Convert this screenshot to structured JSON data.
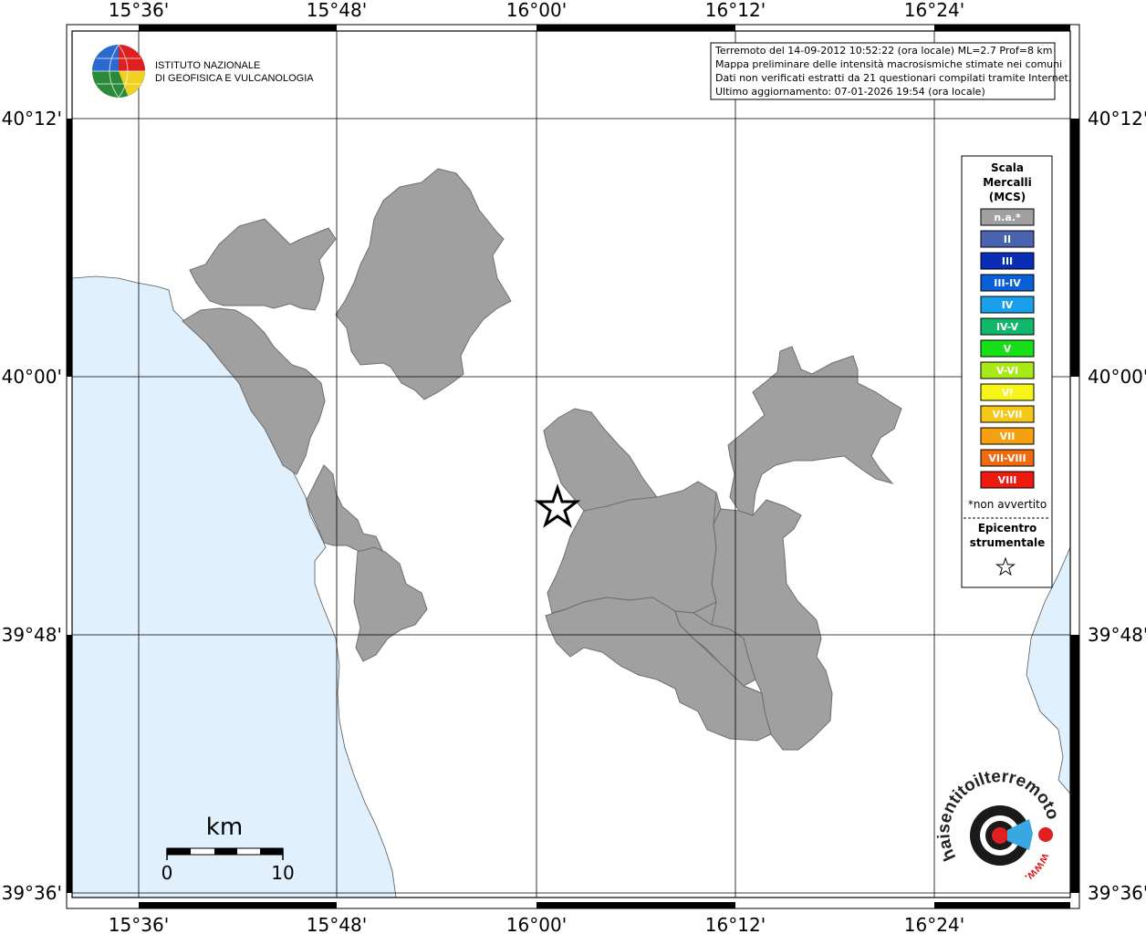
{
  "institute": {
    "line1": "ISTITUTO NAZIONALE",
    "line2": "DI GEOFISICA E VULCANOLOGIA"
  },
  "info": {
    "line1": "Terremoto del 14-09-2012 10:52:22 (ora locale) ML=2.7 Prof=8 km",
    "line2": "Mappa preliminare delle intensità macrosismiche stimate nei comuni",
    "line3": "Dati non verificati estratti da 21 questionari compilati tramite Internet.",
    "line4": "Ultimo aggiornamento: 07-01-2026 19:54 (ora locale)"
  },
  "axes": {
    "top": [
      "15°36'",
      "15°48'",
      "16°00'",
      "16°12'",
      "16°24'"
    ],
    "bottom": [
      "15°36'",
      "15°48'",
      "16°00'",
      "16°12'",
      "16°24'"
    ],
    "left": [
      "40°12'",
      "40°00'",
      "39°48'",
      "39°36'"
    ],
    "right": [
      "40°12'",
      "40°00'",
      "39°48'",
      "39°36'"
    ]
  },
  "legend": {
    "title1": "Scala",
    "title2": "Mercalli",
    "title3": "(MCS)",
    "items": [
      {
        "label": "n.a.*",
        "color": "#a0a0a0"
      },
      {
        "label": "II",
        "color": "#4a63b0"
      },
      {
        "label": "III",
        "color": "#0a2db8"
      },
      {
        "label": "III-IV",
        "color": "#0a5fd6"
      },
      {
        "label": "IV",
        "color": "#18a0ea"
      },
      {
        "label": "IV-V",
        "color": "#12b86a"
      },
      {
        "label": "V",
        "color": "#18e018"
      },
      {
        "label": "V-VI",
        "color": "#a8ea18"
      },
      {
        "label": "VI",
        "color": "#f5f518"
      },
      {
        "label": "VI-VII",
        "color": "#f5c818"
      },
      {
        "label": "VII",
        "color": "#f5a010"
      },
      {
        "label": "VII-VIII",
        "color": "#f06a10"
      },
      {
        "label": "VIII",
        "color": "#ee1a10"
      }
    ],
    "note": "*non avvertito",
    "epi1": "Epicentro",
    "epi2": "strumentale"
  },
  "scale": {
    "unit": "km",
    "min": "0",
    "max": "10"
  },
  "logo": {
    "text": "haisentitoilterremoto.it",
    "www": "www."
  },
  "colors": {
    "sea": "#e0f0fc",
    "felt": "#a0a0a0",
    "frame": "#000000"
  }
}
